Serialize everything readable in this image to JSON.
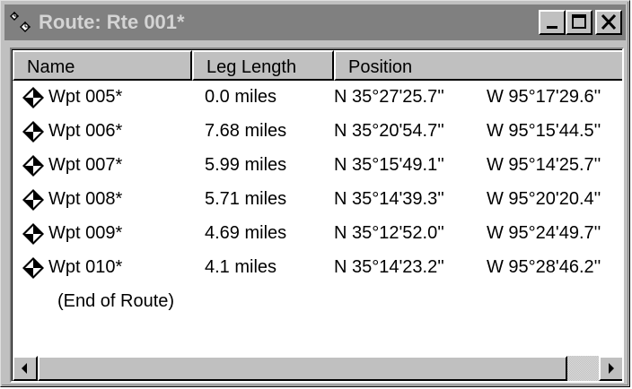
{
  "window": {
    "title": "Route: Rte 001*",
    "title_bar_color": "#808080",
    "title_text_color": "#d4d4d4",
    "app_icon": "route-icon",
    "buttons": {
      "minimize": "minimize-icon",
      "maximize": "maximize-icon",
      "close": "close-icon"
    }
  },
  "list": {
    "columns": [
      "Name",
      "Leg Length",
      "Position"
    ],
    "rows": [
      {
        "icon": "waypoint-icon",
        "name": "Wpt 005*",
        "leg_length": "0.0 miles",
        "lat": "N 35°27'25.7''",
        "lon": "W  95°17'29.6''"
      },
      {
        "icon": "waypoint-icon",
        "name": "Wpt 006*",
        "leg_length": "7.68 miles",
        "lat": "N 35°20'54.7''",
        "lon": "W  95°15'44.5''"
      },
      {
        "icon": "waypoint-icon",
        "name": "Wpt 007*",
        "leg_length": "5.99 miles",
        "lat": "N 35°15'49.1''",
        "lon": "W  95°14'25.7''"
      },
      {
        "icon": "waypoint-icon",
        "name": "Wpt 008*",
        "leg_length": "5.71 miles",
        "lat": "N 35°14'39.3''",
        "lon": "W  95°20'20.4''"
      },
      {
        "icon": "waypoint-icon",
        "name": "Wpt 009*",
        "leg_length": "4.69 miles",
        "lat": "N 35°12'52.0''",
        "lon": "W  95°24'49.7''"
      },
      {
        "icon": "waypoint-icon",
        "name": "Wpt 010*",
        "leg_length": "4.1 miles",
        "lat": "N 35°14'23.2''",
        "lon": "W  95°28'46.2''"
      }
    ],
    "end_label": "(End of Route)"
  },
  "scrollbar": {
    "left_arrow": "arrow-left-icon",
    "right_arrow": "arrow-right-icon"
  }
}
